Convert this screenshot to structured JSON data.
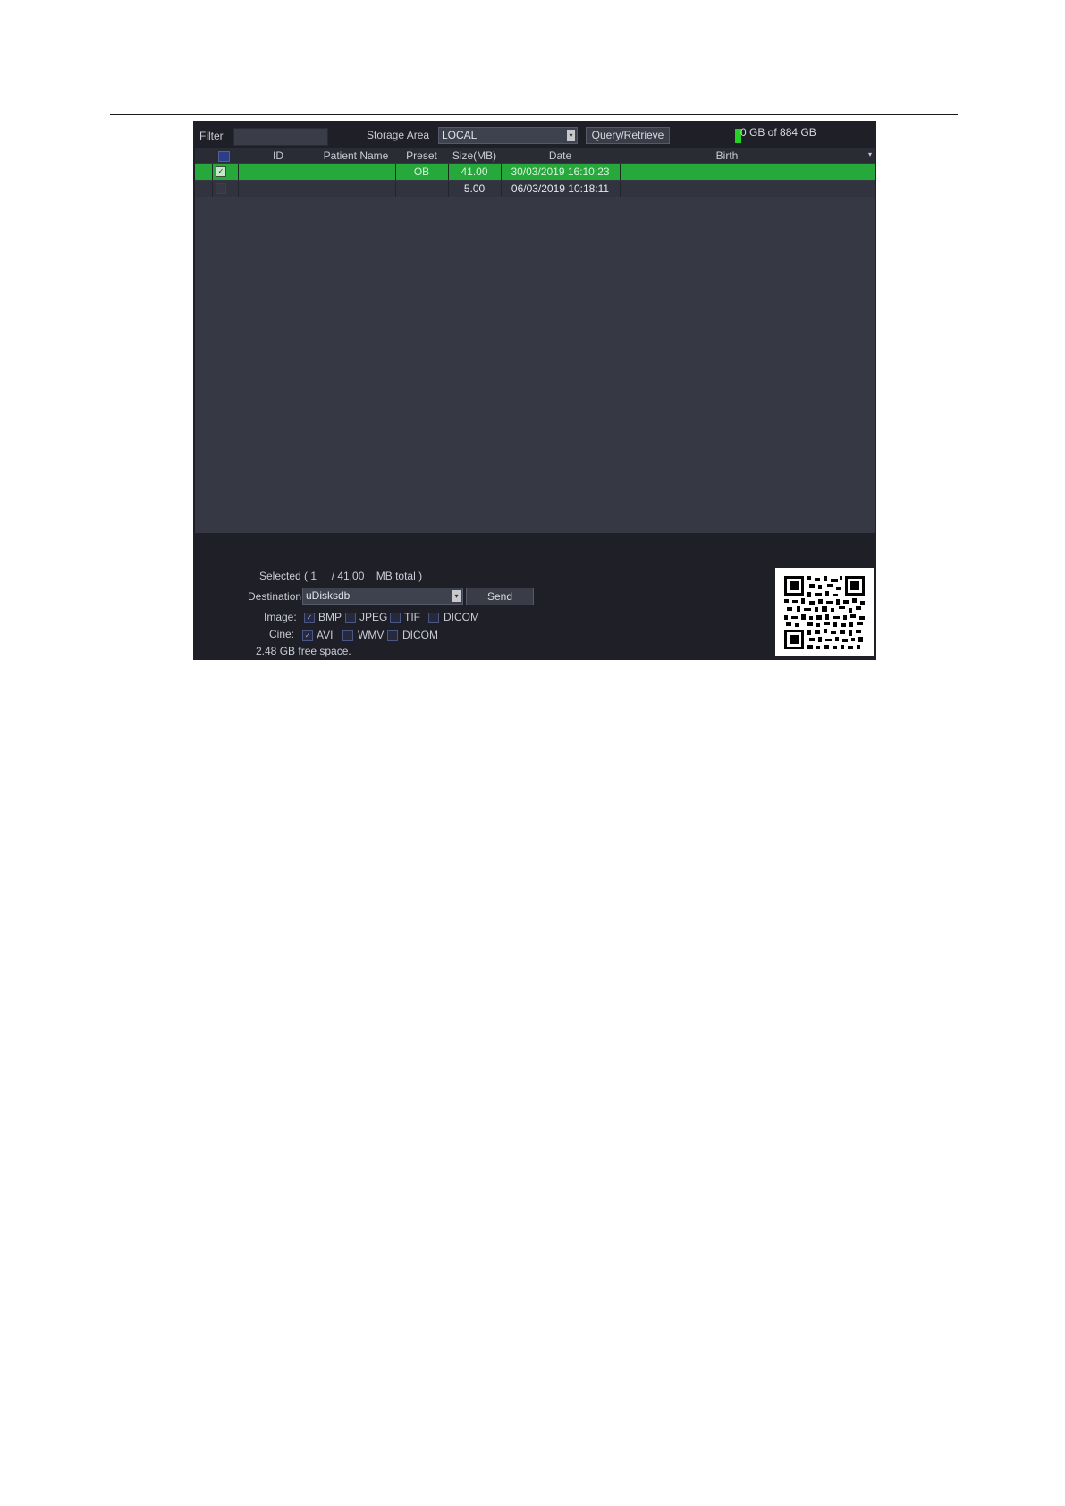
{
  "toolbar": {
    "filter_label": "Filter",
    "filter_value": "",
    "storage_area_label": "Storage Area",
    "storage_area_value": "LOCAL",
    "query_retrieve_label": "Query/Retrieve",
    "disk_usage": "0 GB of 884 GB"
  },
  "table": {
    "columns": [
      "ID",
      "Patient Name",
      "Preset",
      "Size(MB)",
      "Date",
      "Birth"
    ],
    "rows": [
      {
        "checked": true,
        "id": "",
        "patient_name": "",
        "preset": "OB",
        "size": "41.00",
        "date": "30/03/2019 16:10:23",
        "birth": ""
      },
      {
        "checked": false,
        "id": "",
        "patient_name": "",
        "preset": "",
        "size": "5.00",
        "date": "06/03/2019 10:18:11",
        "birth": ""
      }
    ]
  },
  "export": {
    "selected_text": "Selected ( 1     / 41.00    MB total )",
    "destination_label": "Destination",
    "destination_value": "uDisksdb",
    "send_label": "Send",
    "image_label": "Image:",
    "image_options": [
      {
        "label": "BMP",
        "checked": true
      },
      {
        "label": "JPEG",
        "checked": false
      },
      {
        "label": "TIF",
        "checked": false
      },
      {
        "label": "DICOM",
        "checked": false
      }
    ],
    "cine_label": "Cine:",
    "cine_options": [
      {
        "label": "AVI",
        "checked": true
      },
      {
        "label": "WMV",
        "checked": false
      },
      {
        "label": "DICOM",
        "checked": false
      }
    ],
    "free_space": "2.48 GB free space."
  },
  "colors": {
    "selected_row": "#26a83a",
    "panel_bg": "#1e1f27",
    "table_bg": "#363944",
    "disk_indicator": "#25d125"
  }
}
